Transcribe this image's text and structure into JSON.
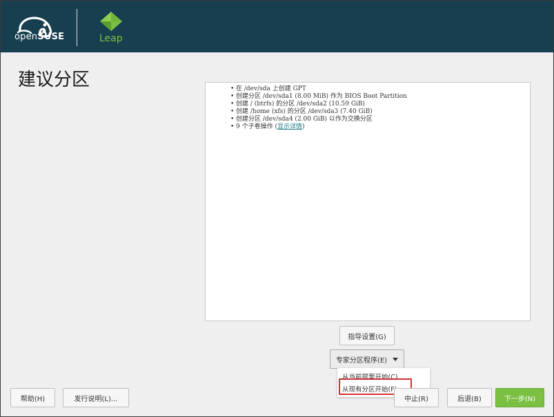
{
  "header": {
    "brand_prefix": "open",
    "brand_suffix": "SUSE",
    "product": "Leap"
  },
  "page": {
    "title": "建议分区"
  },
  "summary": {
    "items": [
      "在 /dev/sda 上创建 GPT",
      "创建分区 /dev/sda1 (8.00 MiB) 作为 BIOS Boot Partition",
      "创建 / (btrfs) 的分区 /dev/sda2 (10.59 GiB)",
      "创建 /home (xfs) 的分区 /dev/sda3 (7.40 GiB)",
      "创建分区 /dev/sda4 (2.00 GiB) 以作为交换分区"
    ],
    "last_item_prefix": "9 个子卷操作 (",
    "last_item_link": "显示详情",
    "last_item_suffix": ")"
  },
  "buttons": {
    "guided_setup": "指导设置(G)",
    "expert_partitioner": "专家分区程序(E)",
    "help": "帮助(H)",
    "release_notes": "发行说明(L)...",
    "abort": "中止(R)",
    "back": "后退(B)",
    "next": "下一步(N)"
  },
  "expert_menu": {
    "items": [
      "从当前提案开始(C)",
      "从现有分区开始(F)"
    ]
  },
  "icons": {
    "chameleon": "opensuse-chameleon-icon",
    "leap": "leap-logo-icon",
    "caret": "caret-down-icon"
  },
  "colors": {
    "header_bg": "#173f4f",
    "accent_green": "#7bc043",
    "link": "#1b7b8f",
    "highlight": "#d32f2f"
  }
}
